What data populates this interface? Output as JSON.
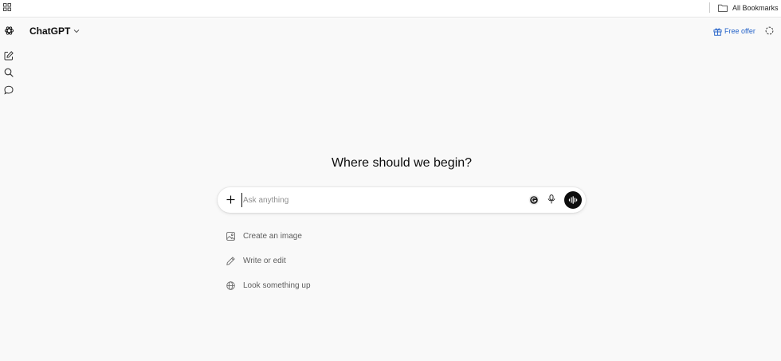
{
  "bookmarks_bar": {
    "apps_icon": "grid-icon",
    "folder_icon": "folder-icon",
    "folder_label": "All Bookmarks"
  },
  "header": {
    "model_name": "ChatGPT",
    "free_offer_label": "Free offer",
    "accent_color": "#2563c9"
  },
  "sidebar": {
    "icons": [
      "openai-logo-icon",
      "new-chat-icon",
      "search-icon",
      "chats-icon"
    ]
  },
  "main": {
    "heading": "Where should we begin?",
    "composer": {
      "placeholder": "Ask anything"
    },
    "suggestions": [
      {
        "label": "Create an image",
        "icon": "image-icon"
      },
      {
        "label": "Write or edit",
        "icon": "pencil-icon"
      },
      {
        "label": "Look something up",
        "icon": "globe-icon"
      }
    ]
  }
}
